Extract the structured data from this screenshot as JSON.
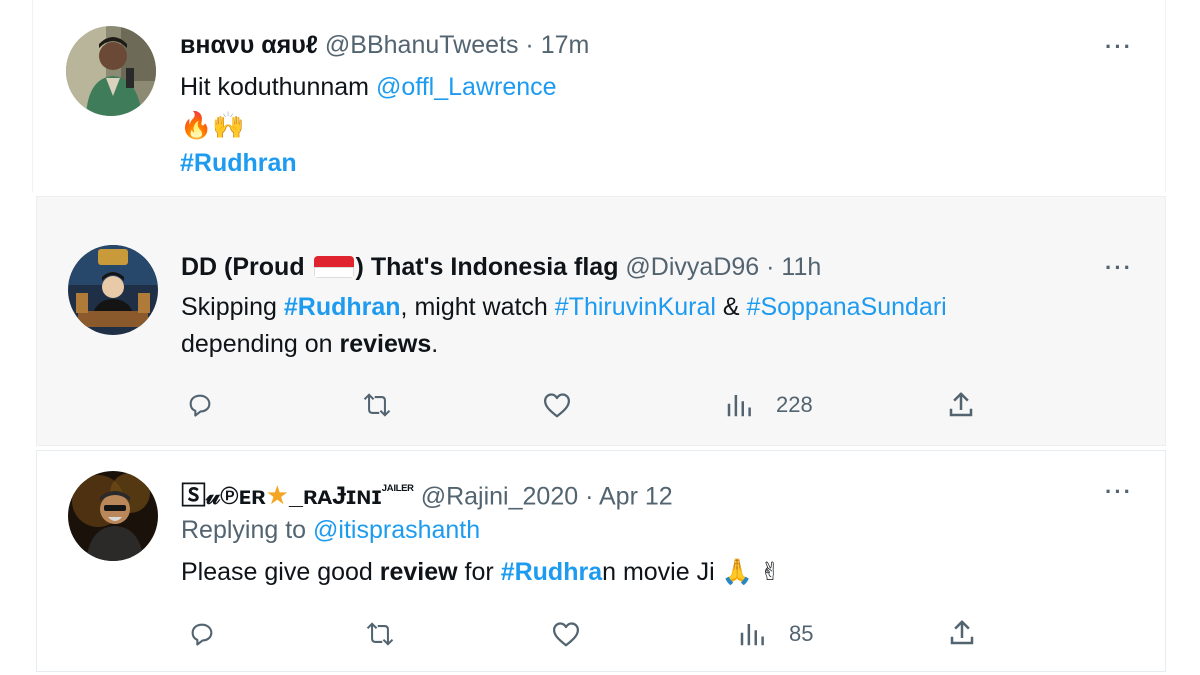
{
  "tweets": [
    {
      "display_name": "ʙнανυ αяυℓ",
      "handle": "@BBhanuTweets",
      "sep": "·",
      "time": "17m",
      "text_1": "Hit koduthunnam ",
      "mention": "@offl_Lawrence",
      "emoji": "🔥🙌",
      "hashtag": "#Rudhran",
      "avatar_icon": "user-avatar-icon",
      "more_icon": "more-options-icon"
    },
    {
      "display_name_a": "DD (Proud ",
      "flag_icon": "indonesia-flag-icon",
      "display_name_b": ") That's Indonesia flag",
      "handle": "@DivyaD96",
      "sep": "·",
      "time": "11h",
      "text_1": "Skipping ",
      "tag_1": "#Rudhran",
      "text_2": ", might watch ",
      "tag_2": "#ThiruvinKural",
      "text_3": " & ",
      "tag_3": "#SoppanaSundari",
      "text_4": "depending on ",
      "bold_1": "reviews",
      "text_5": ".",
      "views": "228",
      "actions": [
        "reply-icon",
        "retweet-icon",
        "like-icon",
        "views-icon",
        "share-icon"
      ]
    },
    {
      "display_name_a": "🅂𝓊℗ᴇʀ",
      "star_icon": "star-icon",
      "display_name_b": "_ʀᴀɈɪɴɪ",
      "display_name_sup": "ᴶᴬᴵᴸᴱᴿ",
      "handle": "@Rajini_2020",
      "sep": "·",
      "time": "Apr 12",
      "reply_prefix": "Replying to ",
      "reply_to": "@itisprashanth",
      "text_1": "Please give good ",
      "bold_1": "review",
      "text_2": " for ",
      "tag_1": "#Rudhra",
      "text_3": "n movie Ji ",
      "emoji": "🙏 ✌",
      "views": "85",
      "actions": [
        "reply-icon",
        "retweet-icon",
        "like-icon",
        "views-icon",
        "share-icon"
      ]
    }
  ],
  "colors": {
    "link": "#1d9bf0",
    "muted": "#536471",
    "text": "#0f1419"
  }
}
